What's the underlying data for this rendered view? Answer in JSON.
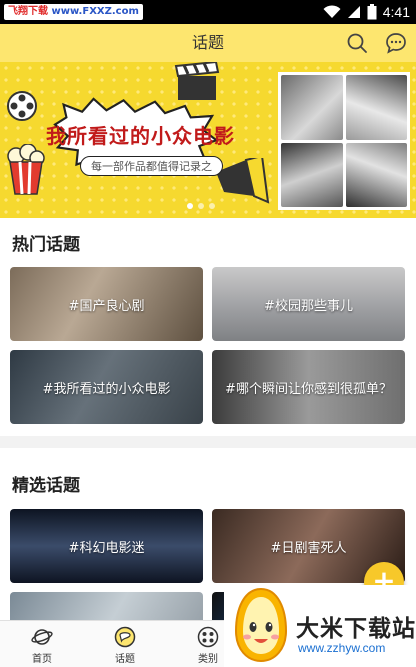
{
  "status_bar": {
    "watermark_a": "飞翔下载",
    "watermark_b": "www.FXXZ.com",
    "time": "4:41"
  },
  "app_bar": {
    "title": "话题",
    "search_icon": "search-icon",
    "message_icon": "chat-bubble-icon"
  },
  "banner": {
    "title": "我所看过的小众电影",
    "subtitle": "每一部作品都值得记录之",
    "page_count": 3,
    "active_page": 1
  },
  "hot_topics": {
    "heading": "热门话题",
    "items": [
      {
        "label": "#国产良心剧"
      },
      {
        "label": "#校园那些事儿"
      },
      {
        "label": "#我所看过的小众电影"
      },
      {
        "label": "#哪个瞬间让你感到很孤单？"
      }
    ]
  },
  "featured_topics": {
    "heading": "精选话题",
    "items": [
      {
        "label": "#科幻电影迷"
      },
      {
        "label": "#日剧害死人"
      },
      {
        "label": ""
      },
      {
        "label": ""
      }
    ]
  },
  "fab": {
    "icon": "plus-icon",
    "symbol": "+"
  },
  "bottom_nav": {
    "items": [
      {
        "label": "首页",
        "icon": "planet-icon"
      },
      {
        "label": "话题",
        "icon": "topic-icon",
        "active": true
      },
      {
        "label": "类别",
        "icon": "category-icon"
      }
    ]
  },
  "overlay": {
    "title": "大米下载站",
    "url": "www.zzhyw.com"
  },
  "colors": {
    "app_bar": "#fde66f",
    "accent": "#f7c82a",
    "banner_title": "#c11a1a"
  }
}
